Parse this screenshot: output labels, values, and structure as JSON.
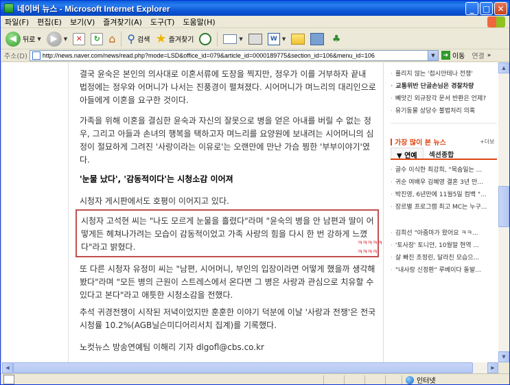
{
  "window": {
    "title": "네이버 뉴스 - Microsoft Internet Explorer",
    "buttons": {
      "minimize": "_",
      "maximize": "□",
      "close": "✕"
    }
  },
  "menu": [
    "파일(F)",
    "편집(E)",
    "보기(V)",
    "즐겨찾기(A)",
    "도구(T)",
    "도움말(H)"
  ],
  "toolbar": {
    "back": "뒤로",
    "search": "검색",
    "favorites": "즐겨찾기"
  },
  "address": {
    "label": "주소(D)",
    "url": "http://news.naver.com/news/read.php?mode=LSD&office_id=079&article_id=0000189775&section_id=106&menu_id=106",
    "go": "이동",
    "links": "연결"
  },
  "article": {
    "p1": "결국 윤숙은 본인의 의사대로 이혼서류에 도장을 찍지만, 정우가 이를 거부하자 끝내 법정에는 정우와 어머니가 나서는 진풍경이 펼쳐졌다. 시어머니가 며느리의 대리인으로 아들에게 이혼을 요구한 것이다.",
    "p2": "가족을 위해 이혼을 결심한 윤숙과 자신의 잘못으로 병을 얻은 아내를 버릴 수 없는 정우, 그리고 아들과 손녀의 행복을 택하고자 며느리를 요양원에 보내려는 시어머니의 심정이 절묘하게 그려진 '사랑이라는 이유로'는 오랜만에 만난 가슴 찡한 '부부이야기'였다.",
    "subhead": "'눈물 났다', '감동적이다'는 시청소감 이어져",
    "p3": "시청자 게시판에서도 호평이 이어지고 있다.",
    "quote": "시청자 고석현 씨는 \"나도 모르게 눈물을 흘렸다\"라며 \"윤숙의 병을 안 남편과 딸이 어떻게든 헤쳐나가려는 모습이 감동적이었고 가족 사랑의 힘을 다시 한 번 강하게 느꼈다\"라고 밝혔다.",
    "scribble": "ㅋㅋㅋㅋㅋㅋㅋㅋㅋ",
    "p4": "또 다른 시청자 유정미 씨는 \"남편, 시어머니, 부인의 입장이라면 어떻게 했을까 생각해봤다\"라며 \"모든 병의 근원이 스트레스에서 온다면 그 병은 사랑과 관심으로 치유할 수 있다고 본다\"라고 애틋한 시청소감을 전했다.",
    "p5": "추석 귀경전쟁이 시작된 저녁이었지만 훈훈한 이야기 덕분에 이날 '사랑과 전쟁'은 전국 시청률 10.2%(AGB닐슨미디어리서치 집계)를 기록했다.",
    "byline": "노컷뉴스 방송연예팀 이해리 기자 dlgofl@cbs.co.kr"
  },
  "rail": {
    "top_list": [
      {
        "text": "풀리지 않는 '접시안테나 전쟁'",
        "bold": false
      },
      {
        "text": "교통위반 단골손님은 경찰차량",
        "bold": true
      },
      {
        "text": "빼앗긴 외규장각 문서 반환은 언제?",
        "bold": false
      },
      {
        "text": "유기동물 상당수 불법처리 의혹",
        "bold": false
      }
    ],
    "most_viewed": "가장 많이 본 뉴스",
    "more": "+더보",
    "tabs": [
      "▼ 연예",
      "섹션종합"
    ],
    "list1": [
      "골수 이식한 최강희, \"목숨일는 ...",
      "귀순 여배우 김혜영 결혼 3년 만...",
      "박진영, 6년만에 11월5일 컴백 \"...",
      "장르별 프로그램 최고 MC는 누구..."
    ],
    "list2": [
      "김희선 \"아줌마가 왔어요 ㅋㅋ...",
      "'토사장' 토니안, 10월말 현역 ...",
      "살 빠진 조정린, 달라진 모습으...",
      "\"내사랑 신정환\" 루베이다 돌발..."
    ]
  },
  "status": {
    "zone": "인터넷"
  }
}
